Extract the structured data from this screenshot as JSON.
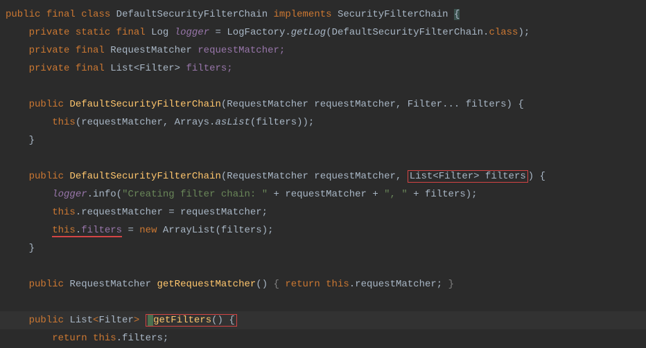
{
  "tokens": {
    "kw_public": "public",
    "kw_final": "final",
    "kw_class": "class",
    "kw_private": "private",
    "kw_static": "static",
    "kw_implements": "implements",
    "kw_this": "this",
    "kw_new": "new",
    "kw_return": "return"
  },
  "line1": {
    "class_decl": "DefaultSecurityFilterChain",
    "interface": "SecurityFilterChain",
    "brace": "{"
  },
  "line2": {
    "type": "Log",
    "name": "logger",
    "eq": " = ",
    "factory": "LogFactory",
    "dot": ".",
    "method": "getLog",
    "arg": "(DefaultSecurityFilterChain.",
    "kw_class_lit": "class",
    "end": ");"
  },
  "line3": {
    "type": "RequestMatcher",
    "name": "requestMatcher;"
  },
  "line4": {
    "type": "List<Filter>",
    "name": "filters;"
  },
  "ctor1": {
    "name": "DefaultSecurityFilterChain",
    "params": "(RequestMatcher requestMatcher, Filter... filters) {",
    "body_this": "this",
    "body_rest": "(requestMatcher, Arrays.",
    "aslist": "asList",
    "body_end": "(filters));",
    "close": "}"
  },
  "ctor2": {
    "name": "DefaultSecurityFilterChain",
    "params_pre": "(RequestMatcher requestMatcher, ",
    "params_boxed": "List<Filter> filters",
    "params_post": ") {",
    "l1_logger": "logger",
    "l1_dot": ".info(",
    "l1_str": "\"Creating filter chain: \"",
    "l1_mid": " + requestMatcher + ",
    "l1_str2": "\", \"",
    "l1_end": " + filters);",
    "l2_this": "this",
    "l2_dot": ".requestMatcher = requestMatcher;",
    "l3_this": "this",
    "l3_dot": ".",
    "l3_field": "filters",
    "l3_eq": " = ",
    "l3_new": "new",
    "l3_rest": " ArrayList(filters);",
    "close": "}"
  },
  "getRM": {
    "type": "RequestMatcher",
    "name": "getRequestMatcher",
    "sig": "() ",
    "open": "{ ",
    "ret": "return",
    "body": " ",
    "this": "this",
    "end": ".requestMatcher; ",
    "close": "}"
  },
  "getFilters": {
    "type_pre": "List",
    "angle_open": "<",
    "type_inner": "Filter",
    "angle_close": ">",
    "name": "getFilters",
    "sig": "() {",
    "ret_kw": "return",
    "ret_this": "this",
    "ret_end": ".filters;"
  }
}
